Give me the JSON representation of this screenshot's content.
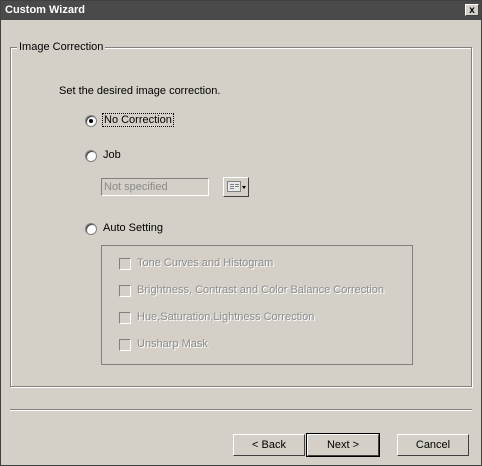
{
  "window": {
    "title": "Custom Wizard",
    "close_label": "x"
  },
  "group": {
    "title": "Image Correction",
    "instruction": "Set the desired image correction."
  },
  "options": {
    "no_correction": {
      "label": "No Correction",
      "selected": true
    },
    "job": {
      "label": "Job",
      "selected": false,
      "input_value": "Not specified"
    },
    "auto_setting": {
      "label": "Auto Setting",
      "selected": false
    }
  },
  "auto_items": [
    {
      "label": "Tone Curves and Histogram",
      "checked": false,
      "enabled": false
    },
    {
      "label": "Brightness, Contrast and Color Balance Correction",
      "checked": false,
      "enabled": false
    },
    {
      "label": "Hue,Saturation,Lightness Correction",
      "checked": false,
      "enabled": false
    },
    {
      "label": "Unsharp Mask",
      "checked": false,
      "enabled": false
    }
  ],
  "buttons": {
    "back": "< Back",
    "next": "Next >",
    "cancel": "Cancel"
  },
  "icons": {
    "picker": "list-view-icon",
    "close": "close-icon"
  }
}
